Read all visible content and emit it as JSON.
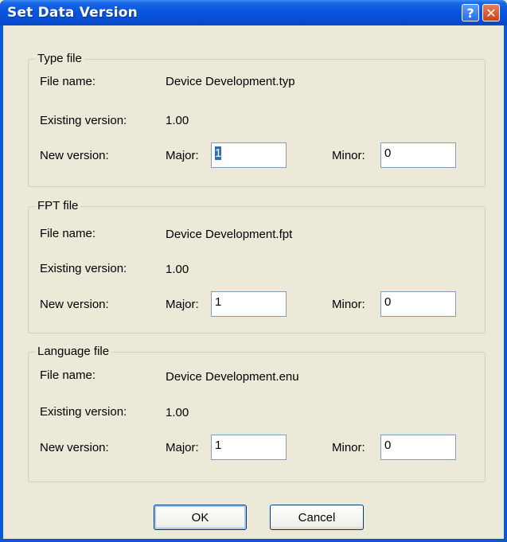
{
  "window": {
    "title": "Set Data Version"
  },
  "titlebar_buttons": {
    "help": "?",
    "close": "✕"
  },
  "groups": [
    {
      "title": "Type file",
      "file_name_label": "File name:",
      "file_name": "Device Development.typ",
      "existing_label": "Existing version:",
      "existing_version": "1.00",
      "new_label": "New version:",
      "major_label": "Major:",
      "major_value": "1",
      "minor_label": "Minor:",
      "minor_value": "0"
    },
    {
      "title": "FPT file",
      "file_name_label": "File name:",
      "file_name": "Device Development.fpt",
      "existing_label": "Existing version:",
      "existing_version": "1.00",
      "new_label": "New version:",
      "major_label": "Major:",
      "major_value": "1",
      "minor_label": "Minor:",
      "minor_value": "0"
    },
    {
      "title": "Language file",
      "file_name_label": "File name:",
      "file_name": "Device Development.enu",
      "existing_label": "Existing version:",
      "existing_version": "1.00",
      "new_label": "New version:",
      "major_label": "Major:",
      "major_value": "1",
      "minor_label": "Minor:",
      "minor_value": "0"
    }
  ],
  "buttons": {
    "ok": "OK",
    "cancel": "Cancel"
  }
}
